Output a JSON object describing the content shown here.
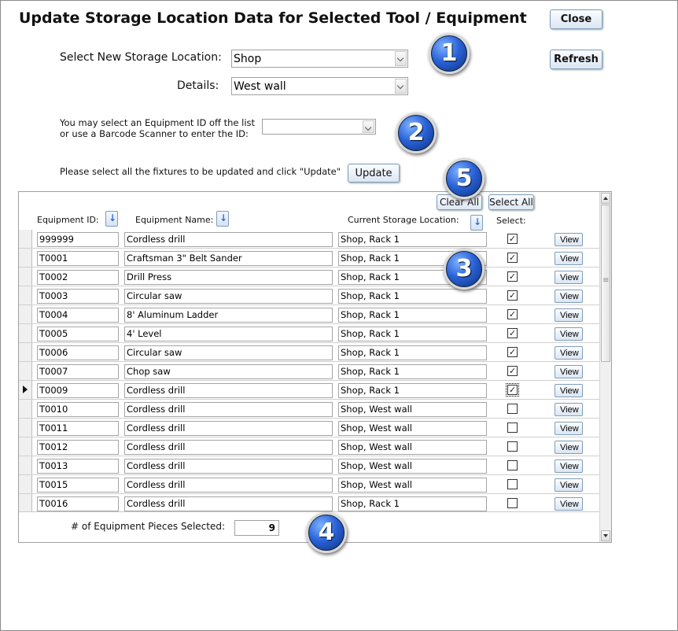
{
  "window": {
    "title": "Update Storage Location Data for Selected Tool / Equipment"
  },
  "buttons": {
    "close": "Close",
    "refresh": "Refresh",
    "update": "Update",
    "clear_all": "Clear All",
    "select_all": "Select All",
    "view": "View"
  },
  "location": {
    "label": "Select New Storage Location:",
    "value": "Shop",
    "details_label": "Details:",
    "details_value": "West wall"
  },
  "equipment_pick": {
    "line1": "You may select an Equipment ID off the list",
    "line2": "or use a Barcode Scanner to enter the ID:",
    "value": ""
  },
  "instruction": "Please select all the fixtures to be updated and click \"Update\"",
  "callouts": [
    "1",
    "2",
    "3",
    "4",
    "5"
  ],
  "columns": {
    "id": "Equipment ID:",
    "name": "Equipment Name:",
    "location": "Current Storage Location:",
    "select": "Select:"
  },
  "rows": [
    {
      "id": "999999",
      "name": "Cordless drill",
      "location": "Shop, Rack 1",
      "selected": "✓"
    },
    {
      "id": "T0001",
      "name": "Craftsman 3\" Belt Sander",
      "location": "Shop, Rack 1",
      "selected": "✓"
    },
    {
      "id": "T0002",
      "name": "Drill Press",
      "location": "Shop, Rack 1",
      "selected": "✓"
    },
    {
      "id": "T0003",
      "name": "Circular saw",
      "location": "Shop, Rack 1",
      "selected": "✓"
    },
    {
      "id": "T0004",
      "name": "8' Aluminum Ladder",
      "location": "Shop, Rack 1",
      "selected": "✓"
    },
    {
      "id": "T0005",
      "name": "4' Level",
      "location": "Shop, Rack 1",
      "selected": "✓"
    },
    {
      "id": "T0006",
      "name": "Circular saw",
      "location": "Shop, Rack 1",
      "selected": "✓"
    },
    {
      "id": "T0007",
      "name": "Chop saw",
      "location": "Shop, Rack 1",
      "selected": "✓"
    },
    {
      "id": "T0009",
      "name": "Cordless drill",
      "location": "Shop, Rack 1",
      "selected": "✓"
    },
    {
      "id": "T0010",
      "name": "Cordless drill",
      "location": "Shop, West wall",
      "selected": ""
    },
    {
      "id": "T0011",
      "name": "Cordless drill",
      "location": "Shop, West wall",
      "selected": ""
    },
    {
      "id": "T0012",
      "name": "Cordless drill",
      "location": "Shop, West wall",
      "selected": ""
    },
    {
      "id": "T0013",
      "name": "Cordless drill",
      "location": "Shop, West wall",
      "selected": ""
    },
    {
      "id": "T0015",
      "name": "Cordless drill",
      "location": "Shop, West wall",
      "selected": ""
    },
    {
      "id": "T0016",
      "name": "Cordless drill",
      "location": "Shop, Rack 1",
      "selected": ""
    }
  ],
  "footer": {
    "count_label": "# of Equipment Pieces Selected:",
    "count_value": "9"
  }
}
